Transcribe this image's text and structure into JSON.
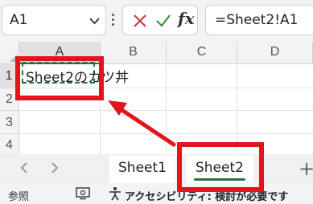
{
  "formula_bar": {
    "name_box": "A1",
    "formula": "=Sheet2!A1"
  },
  "grid": {
    "columns": [
      "A",
      "B",
      "C",
      "D"
    ],
    "rows": [
      "1",
      "2",
      "3",
      "4"
    ],
    "cell_a1": "Sheet2のカツ丼"
  },
  "sheet_tabs": [
    {
      "label": "Sheet1",
      "active": false
    },
    {
      "label": "Sheet2",
      "active": true
    }
  ],
  "status_bar": {
    "mode": "参照",
    "accessibility": "アクセシビリティ: 検討が必要です"
  },
  "colors": {
    "excel_green": "#217346",
    "annotation_red": "#e3141b"
  },
  "icons": [
    "chevron-down-icon",
    "cancel-icon",
    "enter-icon",
    "fx-icon",
    "scroll-left-icon",
    "scroll-right-icon",
    "add-sheet-icon",
    "display-settings-icon",
    "accessibility-icon"
  ]
}
